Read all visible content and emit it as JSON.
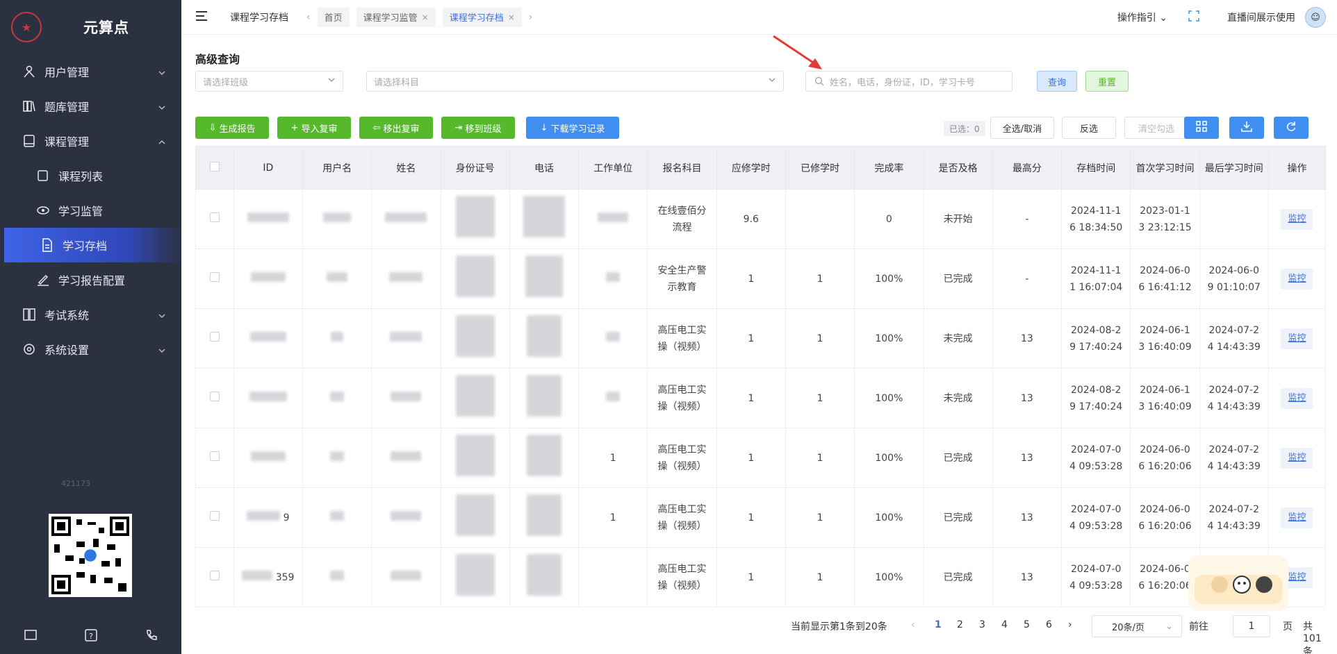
{
  "app": {
    "title": "元算点"
  },
  "sidebar": {
    "items": [
      {
        "label": "用户管理",
        "icon": "users-icon"
      },
      {
        "label": "题库管理",
        "icon": "books-icon"
      },
      {
        "label": "课程管理",
        "icon": "book-icon"
      },
      {
        "label": "课程列表",
        "icon": "list-icon"
      },
      {
        "label": "学习监管",
        "icon": "eye-icon"
      },
      {
        "label": "学习存档",
        "icon": "document-icon"
      },
      {
        "label": "学习报告配置",
        "icon": "pen-icon"
      },
      {
        "label": "考试系统",
        "icon": "exam-icon"
      },
      {
        "label": "系统设置",
        "icon": "gear-icon"
      }
    ],
    "watermark": "421173"
  },
  "header": {
    "current": "课程学习存档",
    "tabs": [
      {
        "label": "首页"
      },
      {
        "label": "课程学习监管"
      },
      {
        "label": "课程学习存档"
      }
    ],
    "guide": "操作指引",
    "user": "直播间展示使用"
  },
  "search": {
    "title": "高级查询",
    "class_placeholder": "请选择班级",
    "subject_placeholder": "请选择科目",
    "keyword_placeholder": "姓名，电话，身份证，ID，学习卡号",
    "query": "查询",
    "reset": "重置"
  },
  "actions": {
    "report": "生成报告",
    "import_review": "导入复审",
    "remove_review": "移出复审",
    "move_class": "移到班级",
    "download": "下载学习记录",
    "selected": "已选：0",
    "select_all": "全选/取消",
    "invert": "反选",
    "clear": "清空勾选"
  },
  "table": {
    "headers": [
      "ID",
      "用户名",
      "姓名",
      "身份证号",
      "电话",
      "工作单位",
      "报名科目",
      "应修学时",
      "已修学时",
      "完成率",
      "是否及格",
      "最高分",
      "存档时间",
      "首次学习时间",
      "最后学习时间",
      "操作"
    ],
    "rows": [
      {
        "id": "",
        "subject": "在线壹佰分\n流程",
        "required": "9.6",
        "done": "",
        "rate": "0",
        "pass": "未开始",
        "score": "-",
        "archived": "2024-11-1\n6 18:34:50",
        "first": "2023-01-1\n3 23:12:15",
        "last": "",
        "work": ""
      },
      {
        "id": "",
        "subject": "安全生产警\n示教育",
        "required": "1",
        "done": "1",
        "rate": "100%",
        "pass": "已完成",
        "score": "-",
        "archived": "2024-11-1\n1 16:07:04",
        "first": "2024-06-0\n6 16:41:12",
        "last": "2024-06-0\n9 01:10:07",
        "work": ""
      },
      {
        "id": "",
        "subject": "高压电工实\n操（视频）",
        "required": "1",
        "done": "1",
        "rate": "100%",
        "pass": "未完成",
        "score": "13",
        "archived": "2024-08-2\n9 17:40:24",
        "first": "2024-06-1\n3 16:40:09",
        "last": "2024-07-2\n4 14:43:39",
        "work": ""
      },
      {
        "id": "",
        "subject": "高压电工实\n操（视频）",
        "required": "1",
        "done": "1",
        "rate": "100%",
        "pass": "未完成",
        "score": "13",
        "archived": "2024-08-2\n9 17:40:24",
        "first": "2024-06-1\n3 16:40:09",
        "last": "2024-07-2\n4 14:43:39",
        "work": ""
      },
      {
        "id": "",
        "subject": "高压电工实\n操（视频）",
        "required": "1",
        "done": "1",
        "rate": "100%",
        "pass": "已完成",
        "score": "13",
        "archived": "2024-07-0\n4 09:53:28",
        "first": "2024-06-0\n6 16:20:06",
        "last": "2024-07-2\n4 14:43:39",
        "work": "1"
      },
      {
        "id": "9",
        "subject": "高压电工实\n操（视频）",
        "required": "1",
        "done": "1",
        "rate": "100%",
        "pass": "已完成",
        "score": "13",
        "archived": "2024-07-0\n4 09:53:28",
        "first": "2024-06-0\n6 16:20:06",
        "last": "2024-07-2\n4 14:43:39",
        "work": "1"
      },
      {
        "id": "359",
        "subject": "高压电工实\n操（视频）",
        "required": "1",
        "done": "1",
        "rate": "100%",
        "pass": "已完成",
        "score": "13",
        "archived": "2024-07-0\n4 09:53:28",
        "first": "2024-06-0\n6 16:20:06",
        "last": "",
        "work": ""
      }
    ],
    "op_label": "监控"
  },
  "pager": {
    "info": "当前显示第1条到20条",
    "pages": [
      "1",
      "2",
      "3",
      "4",
      "5",
      "6"
    ],
    "size": "20条/页",
    "goto": "前往",
    "goto_value": "1",
    "page_word": "页",
    "total": "共 101 条"
  },
  "colors": {
    "sidebar": "#2c3142",
    "active": "#3e63e6",
    "green": "#56b92c",
    "blue": "#3f8ef0"
  }
}
